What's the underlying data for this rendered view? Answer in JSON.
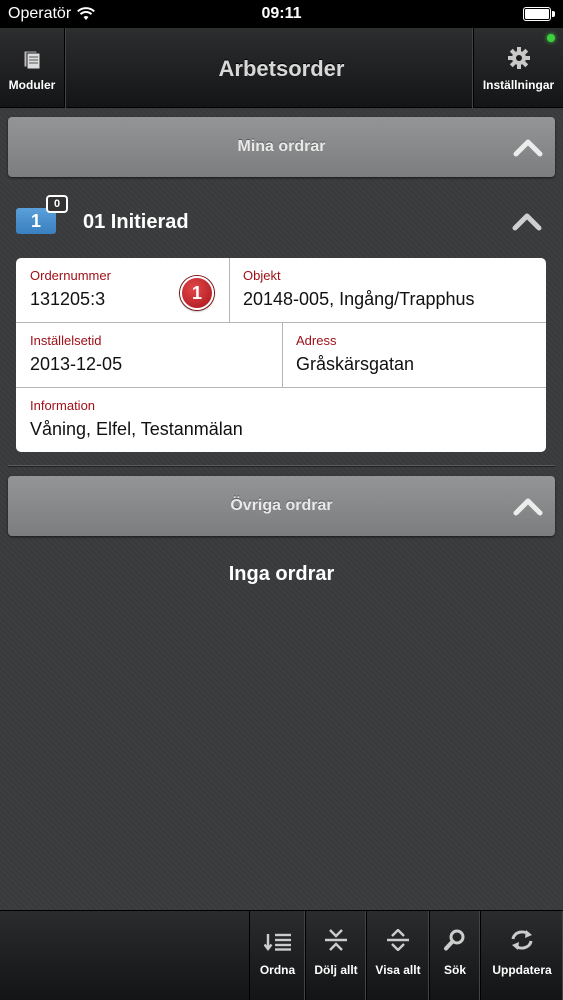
{
  "status_bar": {
    "carrier": "Operatör",
    "time": "09:11"
  },
  "nav": {
    "title": "Arbetsorder",
    "left_label": "Moduler",
    "right_label": "Inställningar"
  },
  "sections": {
    "mine": "Mina ordrar",
    "other": "Övriga ordrar"
  },
  "group": {
    "count": "1",
    "sub_count": "0",
    "title": "01 Initierad"
  },
  "order": {
    "ordernummer_label": "Ordernummer",
    "ordernummer": "131205:3",
    "alert_count": "1",
    "objekt_label": "Objekt",
    "objekt": "20148-005, Ingång/Trapphus",
    "installelsetid_label": "Inställelsetid",
    "installelsetid": "2013-12-05",
    "adress_label": "Adress",
    "adress": "Gråskärsgatan",
    "information_label": "Information",
    "information": "Våning, Elfel, Testanmälan"
  },
  "empty_text": "Inga ordrar",
  "toolbar": {
    "ordna": "Ordna",
    "dolj": "Dölj allt",
    "visa": "Visa allt",
    "sok": "Sök",
    "uppdatera": "Uppdatera"
  },
  "colors": {
    "accent_blue": "#3a7fc0",
    "label_red": "#a01018",
    "alert_red": "#c0252a",
    "online_green": "#3ed13e"
  }
}
